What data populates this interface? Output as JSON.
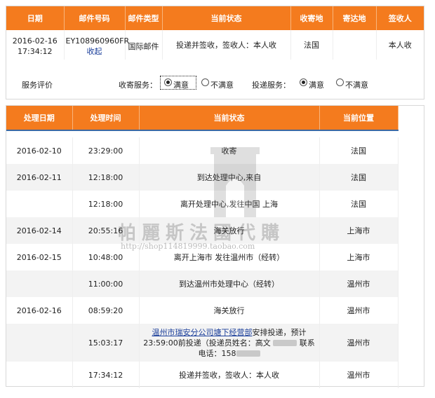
{
  "summary": {
    "headers": [
      "日期",
      "邮件号码",
      "邮件类型",
      "当前状态",
      "收寄地",
      "寄达地",
      "签收人"
    ],
    "row": {
      "date": "2016-02-16 17:34:12",
      "mail_no": "EY108960960FR",
      "collapse_link": "收起",
      "mail_type": "国际邮件",
      "status": "投递并签收，签收人：本人收",
      "origin": "法国",
      "destination": "",
      "signer": "本人收"
    },
    "rating": {
      "label": "服务评价",
      "collect_label": "收寄服务：",
      "deliver_label": "投递服务：",
      "satisfied": "满意",
      "unsatisfied": "不满意",
      "collect_value": "满意",
      "deliver_value": "满意"
    }
  },
  "tracking": {
    "headers": [
      "处理日期",
      "处理时间",
      "当前状态",
      "当前位置"
    ],
    "rows": [
      {
        "date": "2016-02-10",
        "time": "23:29:00",
        "status": "收寄",
        "location": "法国"
      },
      {
        "date": "2016-02-11",
        "time": "12:18:00",
        "status": "到达处理中心,来自",
        "location": "法国"
      },
      {
        "date": "",
        "time": "12:18:00",
        "status": "离开处理中心,发往中国 上海",
        "location": "法国"
      },
      {
        "date": "2016-02-14",
        "time": "20:55:16",
        "status": "海关放行",
        "location": "上海市"
      },
      {
        "date": "2016-02-15",
        "time": "10:48:00",
        "status": "离开上海市 发往温州市（经转）",
        "location": "上海市"
      },
      {
        "date": "",
        "time": "11:00:00",
        "status": "到达温州市处理中心（经转）",
        "location": "温州市"
      },
      {
        "date": "2016-02-16",
        "time": "08:59:20",
        "status": "海关放行",
        "location": "温州市"
      },
      {
        "date": "",
        "time": "15:03:17",
        "status_link": "温州市瑞安分公司塘下经营部",
        "status": "安排投递，预计23:59:00前投递（投递员姓名：高文",
        "status_tail": "联系电话：158",
        "location": "温州市"
      },
      {
        "date": "",
        "time": "17:34:12",
        "status": "投递并签收，签收人：本人收",
        "location": "温州市"
      }
    ]
  },
  "watermark": {
    "text": "帕麗斯法國代購",
    "url": "http://shop114819999.taobao.com"
  }
}
